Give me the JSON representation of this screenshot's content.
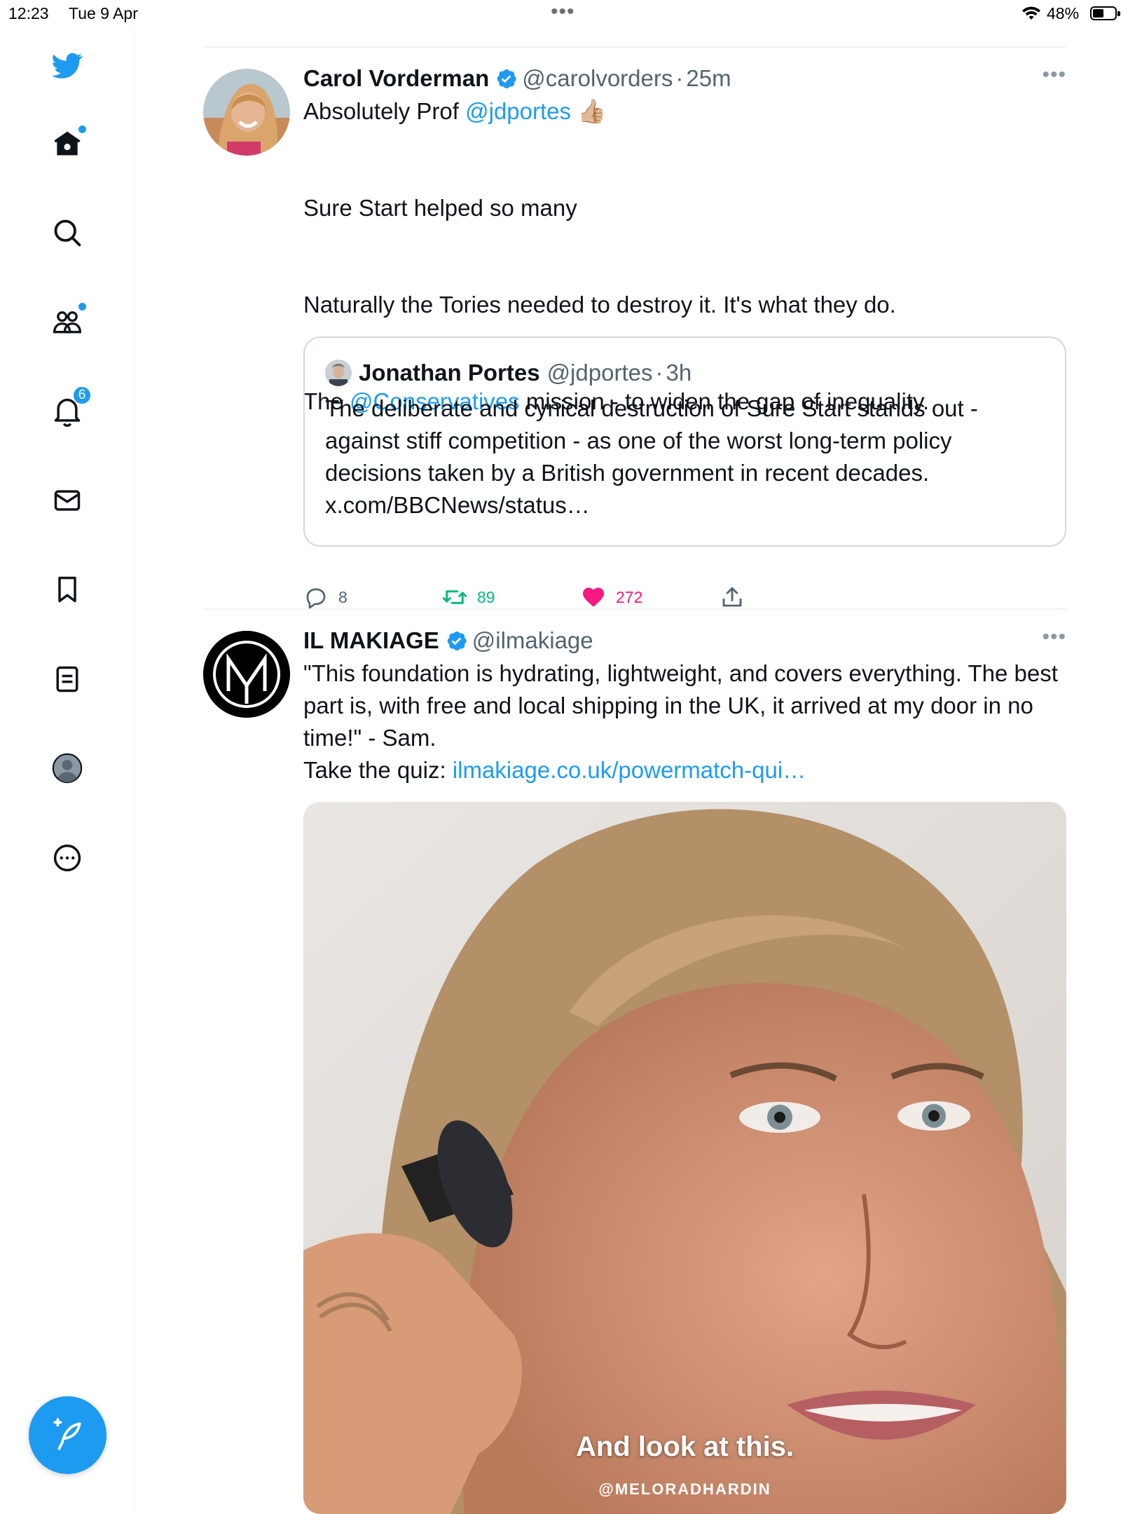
{
  "status_bar": {
    "time": "12:23",
    "date": "Tue 9 Apr",
    "battery": "48%",
    "battery_level": 0.48
  },
  "sidebar": {
    "items": [
      {
        "name": "twitter-logo-icon"
      },
      {
        "name": "home-icon",
        "has_dot": true
      },
      {
        "name": "search-icon"
      },
      {
        "name": "communities-icon",
        "has_dot": true
      },
      {
        "name": "notifications-icon",
        "badge": "6"
      },
      {
        "name": "messages-icon"
      },
      {
        "name": "bookmarks-icon"
      },
      {
        "name": "lists-icon"
      },
      {
        "name": "profile-icon"
      },
      {
        "name": "more-icon"
      }
    ],
    "compose_icon": "compose-feather-icon"
  },
  "tweets": [
    {
      "display_name": "Carol Vorderman",
      "handle": "@carolvorders",
      "separator": "·",
      "time": "25m",
      "text_line1_prefix": "Absolutely Prof ",
      "text_line1_mention": "@jdportes",
      "text_line1_emoji": "👍🏼",
      "text_para2": "Sure Start helped so many",
      "text_para3": "Naturally the Tories needed to destroy it. It's what they do.",
      "text_para4_prefix": "The ",
      "text_para4_mention": "@Conservatives",
      "text_para4_suffix": " mission - to widen the gap of inequality.",
      "quote": {
        "display_name": "Jonathan Portes",
        "handle": "@jdportes",
        "separator": "·",
        "time": "3h",
        "text": "The deliberate and cynical destruction of Sure Start stands out - against stiff competition - as one of the worst long-term policy decisions taken by a British government in recent decades. x.com/BBCNews/status…"
      },
      "actions": {
        "replies": "8",
        "retweets": "89",
        "likes": "272"
      },
      "colors": {
        "retweet": "#00ba7c",
        "like": "#f91880"
      }
    },
    {
      "display_name": "IL MAKIAGE",
      "handle": "@ilmakiage",
      "text": "\"This foundation is hydrating, lightweight, and covers everything. The best part is, with free and local shipping in the UK, it arrived at my door in no time!\" - Sam.",
      "text_quiz_prefix": "Take the quiz: ",
      "text_quiz_link": "ilmakiage.co.uk/powermatch-qui…",
      "video_caption": "And look at this.",
      "video_watermark": "@MELORADHARDIN"
    }
  ],
  "colors": {
    "accent": "#1d9bf0",
    "text": "#0f1419",
    "muted": "#536471"
  }
}
